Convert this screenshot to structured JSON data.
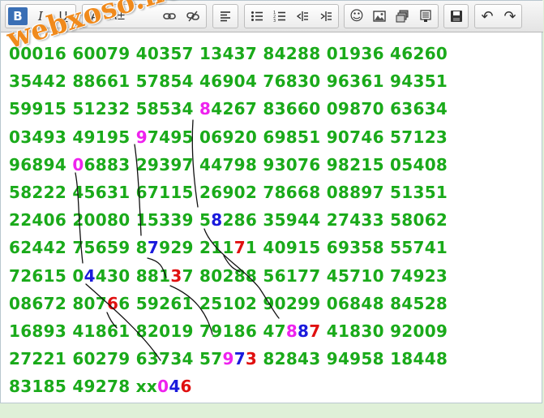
{
  "toolbar": {
    "groups": [
      {
        "buttons": [
          {
            "icon": "bold-icon",
            "glyph": "B"
          },
          {
            "icon": "italic-icon",
            "glyph": "I"
          },
          {
            "icon": "underline-icon",
            "glyph": "U"
          }
        ]
      },
      {
        "buttons": [
          {
            "icon": "font-color-icon",
            "glyph": "A"
          },
          {
            "icon": "font-size-icon",
            "glyph": "A±"
          },
          {
            "icon": "link-icon",
            "glyph": ""
          },
          {
            "icon": "unlink-icon",
            "glyph": ""
          }
        ]
      },
      {
        "buttons": [
          {
            "icon": "align-left-icon",
            "glyph": ""
          }
        ]
      },
      {
        "buttons": [
          {
            "icon": "bullet-list-icon",
            "glyph": ""
          },
          {
            "icon": "numbered-list-icon",
            "glyph": ""
          },
          {
            "icon": "outdent-icon",
            "glyph": ""
          },
          {
            "icon": "indent-icon",
            "glyph": ""
          }
        ]
      },
      {
        "buttons": [
          {
            "icon": "smiley-icon",
            "glyph": "☺"
          },
          {
            "icon": "image-icon",
            "glyph": ""
          },
          {
            "icon": "media-icon",
            "glyph": ""
          },
          {
            "icon": "quote-icon",
            "glyph": ""
          }
        ]
      },
      {
        "buttons": [
          {
            "icon": "save-icon",
            "glyph": ""
          }
        ]
      },
      {
        "buttons": [
          {
            "icon": "undo-icon",
            "glyph": "↶"
          },
          {
            "icon": "redo-icon",
            "glyph": "↷"
          }
        ]
      }
    ]
  },
  "watermark": "webxoso.net",
  "colors": {
    "text": "#1aaa1a",
    "magenta": "#ee22ee",
    "blue": "#1a1adc",
    "red": "#e01010",
    "active_button": "#3a6fb5",
    "watermark": "#f08a1c"
  },
  "lines": [
    [
      {
        "t": "00016 60079 40357 13437 84288 01936 46260"
      }
    ],
    [
      {
        "t": "35442 88661 57854 46904 76830 96361 94351"
      }
    ],
    [
      {
        "t": "59915 51232 58534 "
      },
      {
        "t": "8",
        "c": "magenta"
      },
      {
        "t": "4267 83660 09870 63634"
      }
    ],
    [
      {
        "t": "03493 49195 "
      },
      {
        "t": "9",
        "c": "magenta"
      },
      {
        "t": "7495 06920 69851 90746 57123"
      }
    ],
    [
      {
        "t": "96894 "
      },
      {
        "t": "0",
        "c": "magenta"
      },
      {
        "t": "6883 29397 44798 93076 98215 05408"
      }
    ],
    [
      {
        "t": "58222 45631 67115 26902 78668 08897 51351"
      }
    ],
    [
      {
        "t": "22406 20080 15339 5"
      },
      {
        "t": "8",
        "c": "blue"
      },
      {
        "t": "286 35944 27433 58062"
      }
    ],
    [
      {
        "t": "62442 75659 8"
      },
      {
        "t": "7",
        "c": "blue"
      },
      {
        "t": "929 211"
      },
      {
        "t": "7",
        "c": "red"
      },
      {
        "t": "1 40915 69358 55741"
      }
    ],
    [
      {
        "t": "72615 0"
      },
      {
        "t": "4",
        "c": "blue"
      },
      {
        "t": "430 881"
      },
      {
        "t": "3",
        "c": "red"
      },
      {
        "t": "7 80288 56177 45710 74923"
      }
    ],
    [
      {
        "t": "08672 807"
      },
      {
        "t": "6",
        "c": "red"
      },
      {
        "t": "6 59261 25102 90299 06848 84528"
      }
    ],
    [
      {
        "t": "16893 41861 82019 79186 47"
      },
      {
        "t": "8",
        "c": "magenta"
      },
      {
        "t": "8",
        "c": "blue"
      },
      {
        "t": "7",
        "c": "red"
      },
      {
        "t": " 41830 92009"
      }
    ],
    [
      {
        "t": "27221 60279 63734 57"
      },
      {
        "t": "9",
        "c": "magenta"
      },
      {
        "t": "7",
        "c": "blue"
      },
      {
        "t": "3",
        "c": "red"
      },
      {
        "t": " 82843 94958 18448"
      }
    ],
    [
      {
        "t": "83185 49278 xx"
      },
      {
        "t": "0",
        "c": "magenta"
      },
      {
        "t": "4",
        "c": "blue"
      },
      {
        "t": "6",
        "c": "red"
      }
    ]
  ]
}
